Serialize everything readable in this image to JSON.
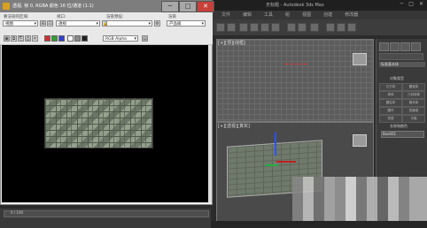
{
  "app": {
    "title": "无标题 - Autodesk 3ds Max",
    "window_buttons": [
      "─",
      "□",
      "✕"
    ],
    "menu": [
      "文件",
      "编辑",
      "工具",
      "组",
      "视图",
      "创建",
      "修改器"
    ],
    "viewports": {
      "top_label": "[+][顶][线框]",
      "persp_label": "[+][透视][真实]"
    }
  },
  "render_window": {
    "title": "透视, 帧 0, RGBA 颜色 16 位/通道 (1:1)",
    "buttons": {
      "minimize": "─",
      "maximize": "□",
      "close": "✕"
    },
    "area_label": "要渲染的区域:",
    "area_value": "视图",
    "viewport_label": "视口:",
    "viewport_value": "透视",
    "preset_label": "渲染预设:",
    "preset_value": "",
    "render_label": "渲染",
    "render_value": "产品级",
    "channel_value": "RGB Alpha"
  },
  "command_panel": {
    "rollout": "标准基本体",
    "object_type": "对象类型",
    "buttons": [
      "长方体",
      "圆锥体",
      "球体",
      "几何球体",
      "圆柱体",
      "管状体",
      "圆环",
      "四棱锥",
      "茶壶",
      "平面"
    ],
    "name_color": "名称和颜色",
    "name_value": "Box001"
  },
  "timeline": {
    "text": "0 / 100"
  },
  "colors": {
    "render_bg": "#000000",
    "title_bar": "#7d7d7d",
    "close_button": "#c8403a",
    "gizmo_red": "#ff3030"
  }
}
